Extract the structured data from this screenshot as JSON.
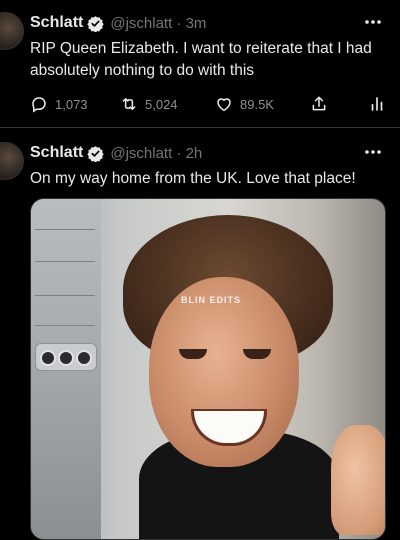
{
  "tweets": [
    {
      "name": "Schlatt",
      "handle": "@jschlatt · 3m",
      "text": "RIP Queen Elizabeth. I want to reiterate that I had absolutely nothing to do with this",
      "actions": {
        "replies": "1,073",
        "retweets": "5,024",
        "likes": "89.5K"
      }
    },
    {
      "name": "Schlatt",
      "handle": "@jschlatt · 2h",
      "text": "On my way home from the UK. Love that place!",
      "media": {
        "watermark": "BLIN EDITS"
      }
    }
  ],
  "colors": {
    "background": "#000000",
    "text": "#e7e9ea",
    "muted": "#71767b",
    "verified_badge": "#e7e9ea"
  },
  "icons": {
    "verified": "verified-badge-icon",
    "more": "more-dots-icon",
    "reply": "reply-icon",
    "retweet": "retweet-icon",
    "like": "heart-icon",
    "share": "share-icon",
    "analytics": "analytics-icon"
  }
}
